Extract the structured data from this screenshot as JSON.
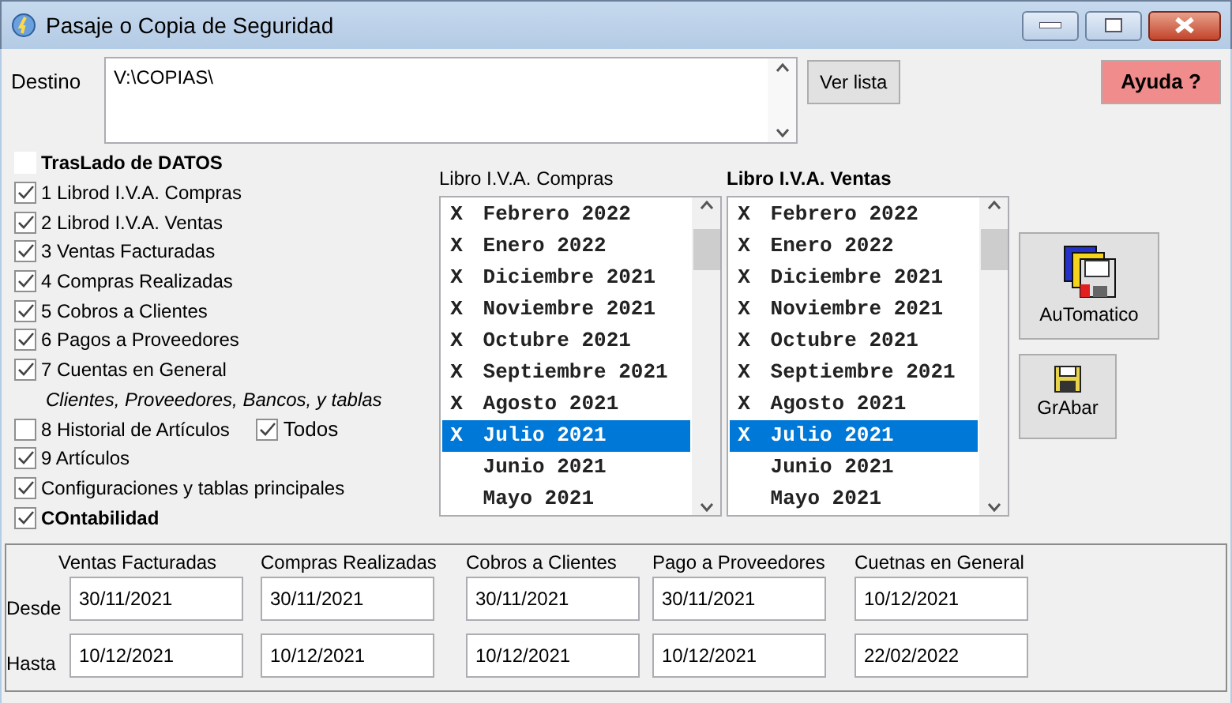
{
  "window": {
    "title": "Pasaje o Copia de Seguridad"
  },
  "destino": {
    "label": "Destino",
    "value": "V:\\COPIAS\\"
  },
  "buttons": {
    "ver_lista": "Ver lista",
    "ayuda": "Ayuda ?",
    "automatico": "AuTomatico",
    "grabar": "GrAbar"
  },
  "options": [
    {
      "kind": "heading",
      "label": "TrasLado de DATOS",
      "checked": false
    },
    {
      "kind": "option",
      "label": "1 Librod I.V.A. Compras",
      "checked": true
    },
    {
      "kind": "option",
      "label": "2 Librod I.V.A. Ventas",
      "checked": true
    },
    {
      "kind": "option",
      "label": "3 Ventas Facturadas",
      "checked": true
    },
    {
      "kind": "option",
      "label": "4 Compras Realizadas",
      "checked": true
    },
    {
      "kind": "option",
      "label": "5 Cobros a Clientes",
      "checked": true
    },
    {
      "kind": "option",
      "label": "6 Pagos a Proveedores",
      "checked": true
    },
    {
      "kind": "option",
      "label": "7 Cuentas en General",
      "checked": true
    },
    {
      "kind": "note",
      "label": "Clientes, Proveedores, Bancos, y tablas"
    },
    {
      "kind": "option",
      "label": "8 Historial de Artículos",
      "checked": false,
      "extra": {
        "label": "Todos",
        "checked": true
      }
    },
    {
      "kind": "option",
      "label": "9 Artículos",
      "checked": true
    },
    {
      "kind": "option",
      "label": "Configuraciones y tablas principales",
      "checked": true
    },
    {
      "kind": "strong",
      "label": "COntabilidad",
      "checked": true
    }
  ],
  "lists": [
    {
      "title": "Libro I.V.A. Compras",
      "bold": false,
      "items": [
        {
          "mark": "X",
          "text": "Febrero 2022",
          "selected": false
        },
        {
          "mark": "X",
          "text": "Enero 2022",
          "selected": false
        },
        {
          "mark": "X",
          "text": "Diciembre 2021",
          "selected": false
        },
        {
          "mark": "X",
          "text": "Noviembre 2021",
          "selected": false
        },
        {
          "mark": "X",
          "text": "Octubre 2021",
          "selected": false
        },
        {
          "mark": "X",
          "text": "Septiembre 2021",
          "selected": false
        },
        {
          "mark": "X",
          "text": "Agosto 2021",
          "selected": false
        },
        {
          "mark": "X",
          "text": "Julio 2021",
          "selected": true
        },
        {
          "text": "Junio 2021",
          "selected": false
        },
        {
          "text": "Mayo 2021",
          "selected": false
        }
      ]
    },
    {
      "title": "Libro I.V.A. Ventas",
      "bold": true,
      "items": [
        {
          "mark": "X",
          "text": "Febrero 2022",
          "selected": false
        },
        {
          "mark": "X",
          "text": "Enero 2022",
          "selected": false
        },
        {
          "mark": "X",
          "text": "Diciembre 2021",
          "selected": false
        },
        {
          "mark": "X",
          "text": "Noviembre 2021",
          "selected": false
        },
        {
          "mark": "X",
          "text": "Octubre 2021",
          "selected": false
        },
        {
          "mark": "X",
          "text": "Septiembre 2021",
          "selected": false
        },
        {
          "mark": "X",
          "text": "Agosto 2021",
          "selected": false
        },
        {
          "mark": "X",
          "text": "Julio 2021",
          "selected": true
        },
        {
          "text": "Junio 2021",
          "selected": false
        },
        {
          "text": "Mayo 2021",
          "selected": false
        }
      ]
    }
  ],
  "dates": {
    "row_labels": [
      "Desde",
      "Hasta"
    ],
    "columns": [
      {
        "heading": "Ventas Facturadas",
        "desde": "30/11/2021",
        "hasta": "10/12/2021"
      },
      {
        "heading": "Compras Realizadas",
        "desde": "30/11/2021",
        "hasta": "10/12/2021"
      },
      {
        "heading": "Cobros a Clientes",
        "desde": "30/11/2021",
        "hasta": "10/12/2021"
      },
      {
        "heading": "Pago a Proveedores",
        "desde": "30/11/2021",
        "hasta": "10/12/2021"
      },
      {
        "heading": "Cuetnas en General",
        "desde": "10/12/2021",
        "hasta": "22/02/2022"
      }
    ]
  }
}
